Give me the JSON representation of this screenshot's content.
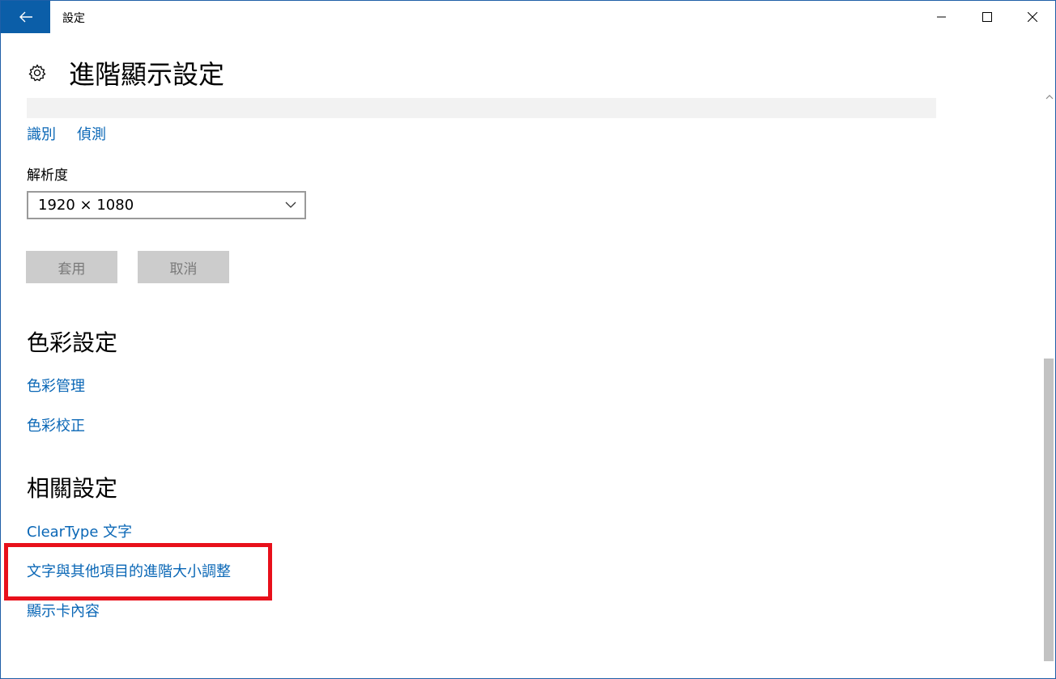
{
  "window": {
    "title": "設定"
  },
  "header": {
    "title": "進階顯示設定"
  },
  "identify_links": {
    "identify": "識別",
    "detect": "偵測"
  },
  "resolution": {
    "label": "解析度",
    "value": "1920 × 1080"
  },
  "buttons": {
    "apply": "套用",
    "cancel": "取消"
  },
  "color_settings": {
    "heading": "色彩設定",
    "color_management": "色彩管理",
    "color_calibration": "色彩校正"
  },
  "related_settings": {
    "heading": "相關設定",
    "cleartype": "ClearType 文字",
    "advanced_sizing": "文字與其他項目的進階大小調整",
    "display_adapter": "顯示卡內容"
  },
  "icons": {
    "back": "back-arrow-icon",
    "gear": "gear-icon",
    "minimize": "minimize-icon",
    "maximize": "maximize-icon",
    "close": "close-icon",
    "chevron": "chevron-down-icon"
  },
  "colors": {
    "accent": "#0b5ea8",
    "link": "#0a67b6",
    "highlight": "#e8101b"
  }
}
